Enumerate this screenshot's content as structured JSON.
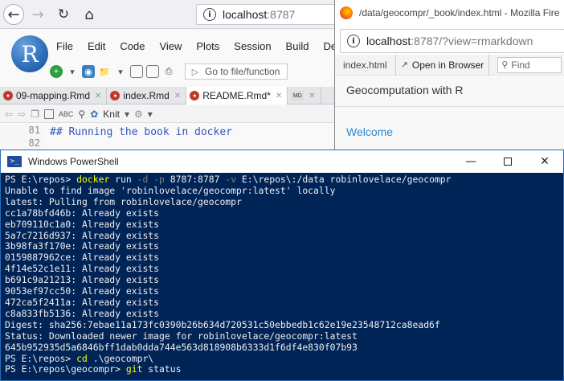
{
  "rstudio_browser": {
    "url_host": "localhost",
    "url_port": ":8787",
    "info_glyph": "i",
    "logo_letter": "R",
    "menu": [
      "File",
      "Edit",
      "Code",
      "View",
      "Plots",
      "Session",
      "Build",
      "De"
    ],
    "goto_placeholder": "Go to file/function",
    "tabs": [
      {
        "label": "09-mapping.Rmd",
        "icon": "rmd-icon",
        "active": false
      },
      {
        "label": "index.Rmd",
        "icon": "rmd-icon",
        "active": false
      },
      {
        "label": "README.Rmd*",
        "icon": "rmd-icon",
        "active": true
      },
      {
        "label": "",
        "icon": "md-icon",
        "active": false
      }
    ],
    "md_icon_text": "MD",
    "knit_label": "Knit",
    "abc_label": "ABC",
    "line_numbers": [
      "81",
      "82"
    ],
    "code_line": "## Running the book in docker"
  },
  "firefox": {
    "title": "/data/geocompr/_book/index.html - Mozilla Fire",
    "url_host": "localhost",
    "url_rest": ":8787/?view=rmarkdown",
    "info_glyph": "i",
    "file_name": "index.html",
    "open_in_browser": "Open in Browser",
    "find_placeholder": "Find",
    "book_title": "Geocomputation with R",
    "welcome_link": "Welcome"
  },
  "powershell": {
    "title": "Windows PowerShell",
    "lines": [
      [
        {
          "t": "PS E:\\repos> ",
          "c": "text"
        },
        {
          "t": "docker",
          "c": "cmd"
        },
        {
          "t": " run ",
          "c": "arg"
        },
        {
          "t": "-d",
          "c": "param"
        },
        {
          "t": " ",
          "c": "arg"
        },
        {
          "t": "-p",
          "c": "param"
        },
        {
          "t": " 8787:8787 ",
          "c": "arg"
        },
        {
          "t": "-v",
          "c": "param"
        },
        {
          "t": " E:\\repos\\:/data robinlovelace/geocompr",
          "c": "arg"
        }
      ],
      [
        {
          "t": "Unable to find image 'robinlovelace/geocompr:latest' locally",
          "c": "text"
        }
      ],
      [
        {
          "t": "latest: Pulling from robinlovelace/geocompr",
          "c": "text"
        }
      ],
      [
        {
          "t": "cc1a78bfd46b: Already exists",
          "c": "text"
        }
      ],
      [
        {
          "t": "eb709110c1a0: Already exists",
          "c": "text"
        }
      ],
      [
        {
          "t": "5a7c7216d937: Already exists",
          "c": "text"
        }
      ],
      [
        {
          "t": "3b98fa3f170e: Already exists",
          "c": "text"
        }
      ],
      [
        {
          "t": "0159887962ce: Already exists",
          "c": "text"
        }
      ],
      [
        {
          "t": "4f14e52c1e11: Already exists",
          "c": "text"
        }
      ],
      [
        {
          "t": "b691c9a21213: Already exists",
          "c": "text"
        }
      ],
      [
        {
          "t": "9053ef97cc50: Already exists",
          "c": "text"
        }
      ],
      [
        {
          "t": "472ca5f2411a: Already exists",
          "c": "text"
        }
      ],
      [
        {
          "t": "c8a833fb5136: Already exists",
          "c": "text"
        }
      ],
      [
        {
          "t": "Digest: sha256:7ebae11a173fc0390b26b634d720531c50ebbedb1c62e19e23548712ca8ead6f",
          "c": "text"
        }
      ],
      [
        {
          "t": "Status: Downloaded newer image for robinlovelace/geocompr:latest",
          "c": "text"
        }
      ],
      [
        {
          "t": "645b952935d5a6846bff1dab0dda744e563d818908b6333d1f6df4e830f07b93",
          "c": "text"
        }
      ],
      [
        {
          "t": "PS E:\\repos> ",
          "c": "text"
        },
        {
          "t": "cd",
          "c": "cmd"
        },
        {
          "t": " .\\geocompr\\",
          "c": "arg"
        }
      ],
      [
        {
          "t": "PS E:\\repos\\geocompr> ",
          "c": "text"
        },
        {
          "t": "git",
          "c": "cmd"
        },
        {
          "t": " status",
          "c": "arg"
        }
      ]
    ]
  },
  "colors": {
    "ps_background": "#012456",
    "ps_command": "#ffff00",
    "ps_text": "#eeedf0",
    "rmd_icon": "#c0392b",
    "welcome_link": "#2a8ad4"
  }
}
